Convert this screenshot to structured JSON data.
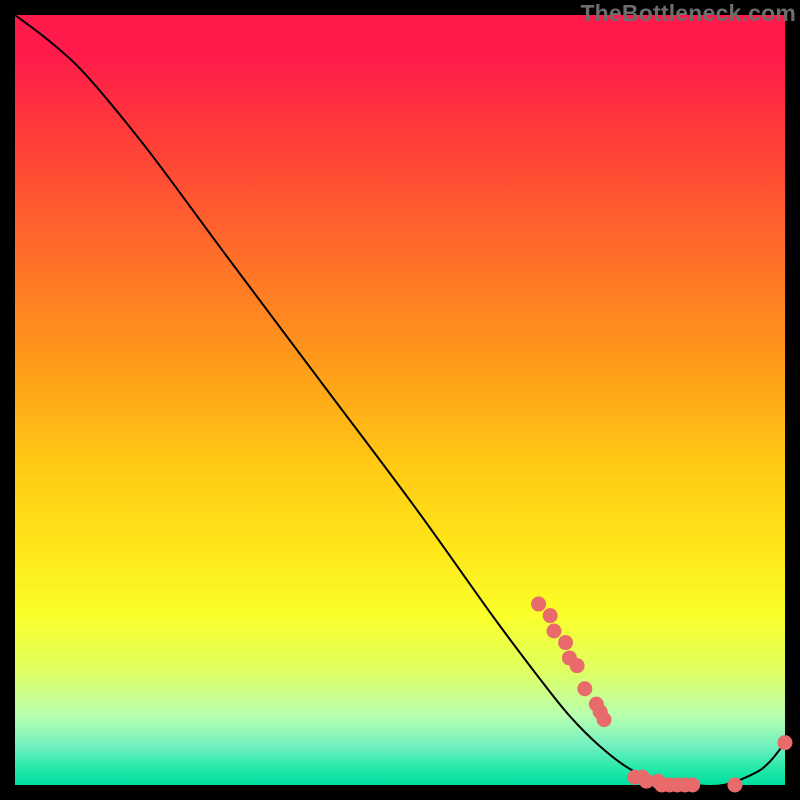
{
  "watermark": "TheBottleneck.com",
  "colors": {
    "curve_stroke": "#000000",
    "dot_fill": "#e86a6a",
    "dot_stroke": "#b04848"
  },
  "chart_data": {
    "type": "line",
    "title": "",
    "xlabel": "",
    "ylabel": "",
    "xlim": [
      0,
      100
    ],
    "ylim": [
      0,
      100
    ],
    "series": [
      {
        "name": "curve",
        "x": [
          0,
          4,
          8,
          12,
          18,
          28,
          40,
          52,
          62,
          68,
          72,
          76,
          80,
          84,
          88,
          92,
          96,
          98,
          100
        ],
        "y": [
          100,
          97,
          93.5,
          89,
          81.5,
          68,
          52,
          36,
          22,
          14,
          9,
          5,
          2,
          0.5,
          0,
          0,
          1.5,
          3,
          5.5
        ]
      }
    ],
    "dots": [
      {
        "x": 68.0,
        "y": 23.5
      },
      {
        "x": 69.5,
        "y": 22.0
      },
      {
        "x": 70.0,
        "y": 20.0
      },
      {
        "x": 71.5,
        "y": 18.5
      },
      {
        "x": 72.0,
        "y": 16.5
      },
      {
        "x": 73.0,
        "y": 15.5
      },
      {
        "x": 74.0,
        "y": 12.5
      },
      {
        "x": 75.5,
        "y": 10.5
      },
      {
        "x": 76.0,
        "y": 9.5
      },
      {
        "x": 76.5,
        "y": 8.5
      },
      {
        "x": 80.5,
        "y": 1.0
      },
      {
        "x": 81.5,
        "y": 1.0
      },
      {
        "x": 82.0,
        "y": 0.5
      },
      {
        "x": 83.5,
        "y": 0.5
      },
      {
        "x": 84.0,
        "y": 0.0
      },
      {
        "x": 85.0,
        "y": 0.0
      },
      {
        "x": 86.0,
        "y": 0.0
      },
      {
        "x": 87.0,
        "y": 0.0
      },
      {
        "x": 88.0,
        "y": 0.0
      },
      {
        "x": 93.5,
        "y": 0.0
      },
      {
        "x": 100.0,
        "y": 5.5
      }
    ]
  }
}
